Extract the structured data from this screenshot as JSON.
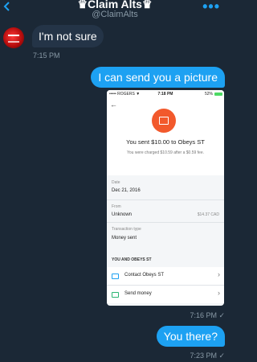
{
  "header": {
    "title": "♛Claim Alts♛",
    "handle": "@ClaimAlts",
    "more": "•••"
  },
  "messages": {
    "in1": {
      "text": "I'm not sure",
      "time": "7:15 PM"
    },
    "out1": {
      "text": "I can send you a picture",
      "time": "7:16 PM ✓"
    },
    "out2": {
      "text": "You there?",
      "time": "7:23 PM ✓"
    }
  },
  "screenshot": {
    "carrier": "••••• ROGERS ▼",
    "clock": "7:18 PM",
    "battery": "52%",
    "sent_title": "You sent $10.00 to Obeys ST",
    "fee_text": "You were charged $10.59 after a $0.59 fee.",
    "date_label": "Date",
    "date_value": "Dec 21, 2016",
    "from_label": "From",
    "from_value": "Unknown",
    "from_amount": "$14.37 CAD",
    "type_label": "Transaction type",
    "type_value": "Money sent",
    "section": "YOU AND OBEYS ST",
    "contact": "Contact Obeys ST",
    "send": "Send money"
  }
}
